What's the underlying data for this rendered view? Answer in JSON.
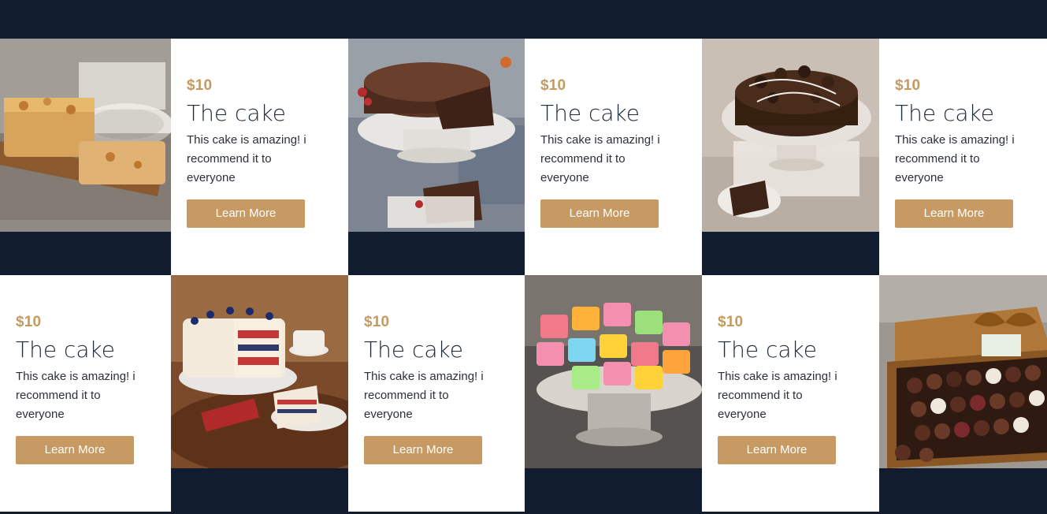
{
  "colors": {
    "background": "#111d2e",
    "accent": "#c69a62",
    "card": "#ffffff"
  },
  "cards": [
    {
      "price": "$10",
      "title": "The cake",
      "description": "This cake is amazing! i recommend it to everyone",
      "button": "Learn More"
    },
    {
      "price": "$10",
      "title": "The cake",
      "description": "This cake is amazing! i recommend it to everyone",
      "button": "Learn More"
    },
    {
      "price": "$10",
      "title": "The cake",
      "description": "This cake is amazing! i recommend it to everyone",
      "button": "Learn More"
    },
    {
      "price": "$10",
      "title": "The cake",
      "description": "This cake is amazing! i recommend it to everyone",
      "button": "Learn More"
    },
    {
      "price": "$10",
      "title": "The cake",
      "description": "This cake is amazing! i recommend it to everyone",
      "button": "Learn More"
    },
    {
      "price": "$10",
      "title": "The cake",
      "description": "This cake is amazing! i recommend it to everyone",
      "button": "Learn More"
    }
  ],
  "images": [
    {
      "icon": "nut-loaf-cake-image"
    },
    {
      "icon": "chocolate-cake-image"
    },
    {
      "icon": "chocolate-truffle-cake-image"
    },
    {
      "icon": "layer-cake-image"
    },
    {
      "icon": "petit-fours-image"
    },
    {
      "icon": "truffle-box-image"
    }
  ]
}
